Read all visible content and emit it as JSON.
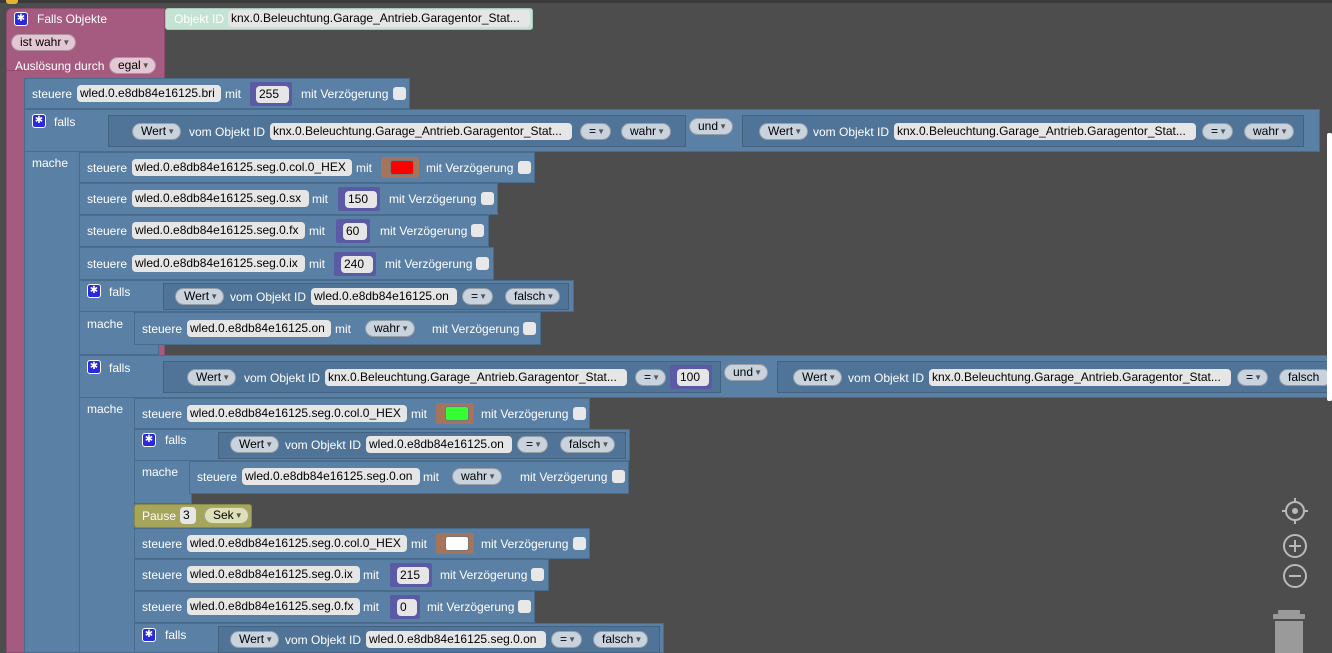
{
  "event": {
    "title": "Falls Objekte",
    "object_label": "Objekt ID",
    "object_id": "knx.0.Beleuchtung.Garage_Antrieb.Garagentor_Stat...",
    "condition": "ist wahr",
    "trigger_label": "Auslösung durch",
    "trigger": "egal"
  },
  "words": {
    "steuere": "steuere",
    "mit": "mit",
    "delay": "mit Verzögerung",
    "falls": "falls",
    "mache": "mache",
    "wert": "Wert",
    "vom": "vom Objekt ID",
    "eq": "=",
    "und": "und",
    "pause": "Pause",
    "sek": "Sek"
  },
  "row1": {
    "id": "wled.0.e8db84e16125.bri",
    "val": "255"
  },
  "if1": {
    "a_id": "knx.0.Beleuchtung.Garage_Antrieb.Garagentor_Stat...",
    "a_val": "wahr",
    "b_id": "knx.0.Beleuchtung.Garage_Antrieb.Garagentor_Stat...",
    "b_val": "wahr"
  },
  "s1": {
    "id": "wled.0.e8db84e16125.seg.0.col.0_HEX",
    "color": "#ff0000"
  },
  "s2": {
    "id": "wled.0.e8db84e16125.seg.0.sx",
    "val": "150"
  },
  "s3": {
    "id": "wled.0.e8db84e16125.seg.0.fx",
    "val": "60"
  },
  "s4": {
    "id": "wled.0.e8db84e16125.seg.0.ix",
    "val": "240"
  },
  "if2": {
    "id": "wled.0.e8db84e16125.on",
    "val": "falsch",
    "set_id": "wled.0.e8db84e16125.on",
    "set_val": "wahr"
  },
  "if3": {
    "a_id": "knx.0.Beleuchtung.Garage_Antrieb.Garagentor_Stat...",
    "a_val": "100",
    "b_id": "knx.0.Beleuchtung.Garage_Antrieb.Garagentor_Stat...",
    "b_val": "falsch"
  },
  "s5": {
    "id": "wled.0.e8db84e16125.seg.0.col.0_HEX",
    "color": "#33ff33"
  },
  "if4": {
    "id": "wled.0.e8db84e16125.on",
    "val": "falsch",
    "set_id": "wled.0.e8db84e16125.seg.0.on",
    "set_val": "wahr"
  },
  "pause": {
    "val": "3"
  },
  "s6": {
    "id": "wled.0.e8db84e16125.seg.0.col.0_HEX",
    "color": "#ffffff"
  },
  "s7": {
    "id": "wled.0.e8db84e16125.seg.0.ix",
    "val": "215"
  },
  "s8": {
    "id": "wled.0.e8db84e16125.seg.0.fx",
    "val": "0"
  },
  "if5": {
    "id": "wled.0.e8db84e16125.seg.0.on",
    "val": "falsch"
  },
  "icons": {
    "gear": "gear-icon",
    "center": "crosshair-icon",
    "zoom_in": "zoom-in-icon",
    "zoom_out": "zoom-out-icon",
    "trash": "trash-icon"
  },
  "colors": {
    "event_block": "#a55b80",
    "logic_block": "#5b80a5",
    "math_block": "#5b5ba5",
    "timer_block": "#a5a55b",
    "workspace": "#4d4d4d"
  }
}
